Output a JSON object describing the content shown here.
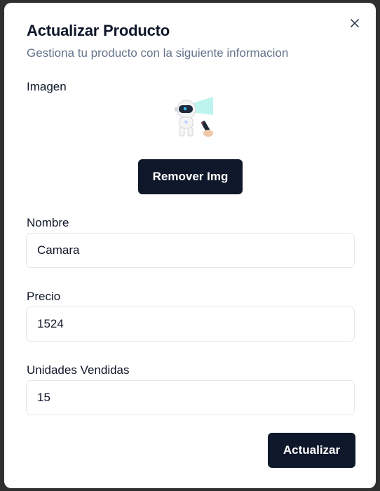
{
  "dialog": {
    "title": "Actualizar Producto",
    "subtitle": "Gestiona tu producto con la siguiente informacion",
    "close_icon": "close-icon"
  },
  "image_section": {
    "label": "Imagen",
    "image": "product-robot-projector",
    "remove_label": "Remover Img"
  },
  "fields": {
    "name": {
      "label": "Nombre",
      "value": "Camara"
    },
    "price": {
      "label": "Precio",
      "value": "1524"
    },
    "units_sold": {
      "label": "Unidades Vendidas",
      "value": "15"
    }
  },
  "actions": {
    "submit_label": "Actualizar"
  },
  "colors": {
    "primary": "#0f172a",
    "muted": "#64748b",
    "border": "#e2e8f0"
  }
}
